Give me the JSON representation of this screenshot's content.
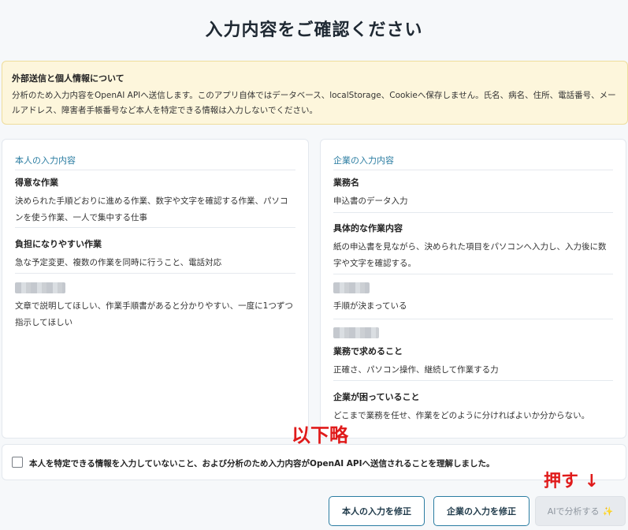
{
  "page": {
    "title": "入力内容をご確認ください"
  },
  "notice": {
    "title": "外部送信と個人情報について",
    "body": "分析のため入力内容をOpenAI APIへ送信します。このアプリ自体ではデータベース、localStorage、Cookieへ保存しません。氏名、病名、住所、電話番号、メールアドレス、障害者手帳番号など本人を特定できる情報は入力しないでください。"
  },
  "self_card": {
    "heading": "本人の入力内容",
    "items": [
      {
        "label": "得意な作業",
        "value": "決められた手順どおりに進める作業、数字や文字を確認する作業、パソコンを使う作業、一人で集中する仕事"
      },
      {
        "label": "負担になりやすい作業",
        "value": "急な予定変更、複数の作業を同時に行うこと、電話対応"
      },
      {
        "label": "",
        "value": "文章で説明してほしい、作業手順書があると分かりやすい、一度に1つずつ指示してほしい"
      }
    ]
  },
  "company_card": {
    "heading": "企業の入力内容",
    "items": [
      {
        "label": "業務名",
        "value": "申込書のデータ入力"
      },
      {
        "label": "具体的な作業内容",
        "value": "紙の申込書を見ながら、決められた項目をパソコンへ入力し、入力後に数字や文字を確認する。"
      },
      {
        "label": "",
        "value": "手順が決まっている"
      },
      {
        "label": "業務で求めること",
        "value": "正確さ、パソコン操作、継続して作業する力"
      },
      {
        "label": "企業が困っていること",
        "value": "どこまで業務を任せ、作業をどのように分ければよいか分からない。"
      }
    ]
  },
  "annotations": {
    "omitted": "以下略",
    "press": "押す ↓"
  },
  "confirm": {
    "checked": false,
    "text": "本人を特定できる情報を入力していないこと、および分析のため入力内容がOpenAI APIへ送信されることを理解しました。"
  },
  "buttons": {
    "edit_self": "本人の入力を修正",
    "edit_company": "企業の入力を修正",
    "analyze": "AIで分析する",
    "analyze_icon": "sparkle-icon"
  },
  "colors": {
    "accent": "#2b7da2",
    "notice_bg": "#fdf6dc",
    "annotation": "#e01b1b"
  }
}
